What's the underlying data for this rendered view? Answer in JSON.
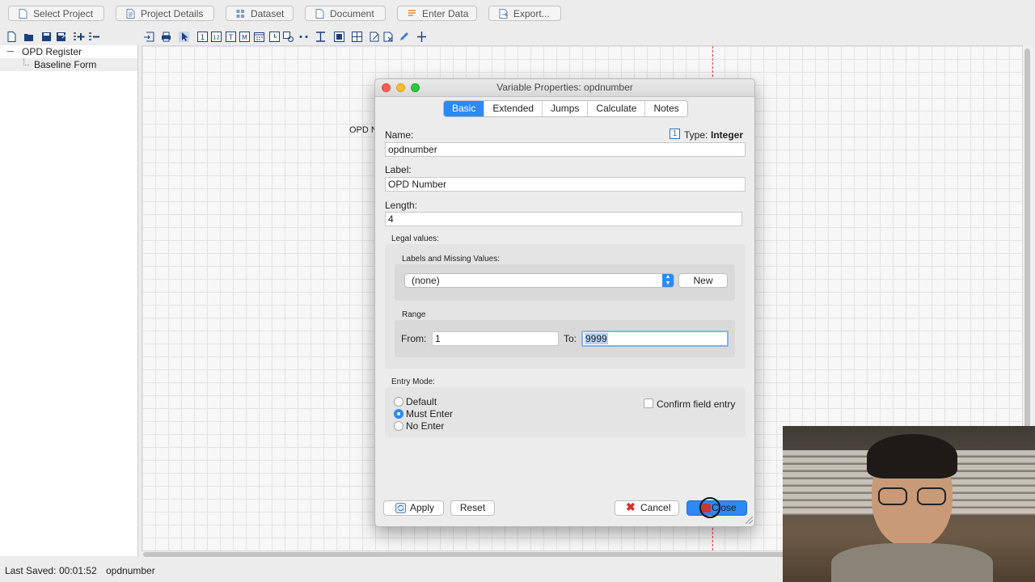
{
  "topbar": {
    "buttons": [
      "Select Project",
      "Project Details",
      "Dataset",
      "Document",
      "Enter Data",
      "Export..."
    ]
  },
  "tree": {
    "root": "OPD Register",
    "child": "Baseline Form"
  },
  "canvas": {
    "field_label_partial": "OPD N"
  },
  "status": {
    "last_saved_label": "Last Saved:",
    "last_saved_time": "00:01:52",
    "current_field": "opdnumber"
  },
  "dialog": {
    "title": "Variable Properties: opdnumber",
    "tabs": [
      "Basic",
      "Extended",
      "Jumps",
      "Calculate",
      "Notes"
    ],
    "active_tab": "Basic",
    "name_label": "Name:",
    "name_value": "opdnumber",
    "type_badge": "1",
    "type_label": "Type:",
    "type_value": "Integer",
    "label_label": "Label:",
    "label_value": "OPD Number",
    "length_label": "Length:",
    "length_value": "4",
    "legal_values_label": "Legal values:",
    "lmv_label": "Labels and Missing Values:",
    "lmv_select": "(none)",
    "new_button": "New",
    "range_label": "Range",
    "from_label": "From:",
    "from_value": "1",
    "to_label": "To:",
    "to_value": "9999",
    "entry_mode_label": "Entry Mode:",
    "entry_modes": [
      "Default",
      "Must Enter",
      "No Enter"
    ],
    "selected_entry_mode": "Must Enter",
    "confirm_label": "Confirm field entry",
    "apply_button": "Apply",
    "reset_button": "Reset",
    "cancel_button": "Cancel",
    "close_button": "Close"
  },
  "colors": {
    "accent": "#2d8af4",
    "cancel_x": "#d62c2c",
    "close_light": "#fc5f57",
    "min_light": "#fdbc2e",
    "max_light": "#28c840"
  }
}
